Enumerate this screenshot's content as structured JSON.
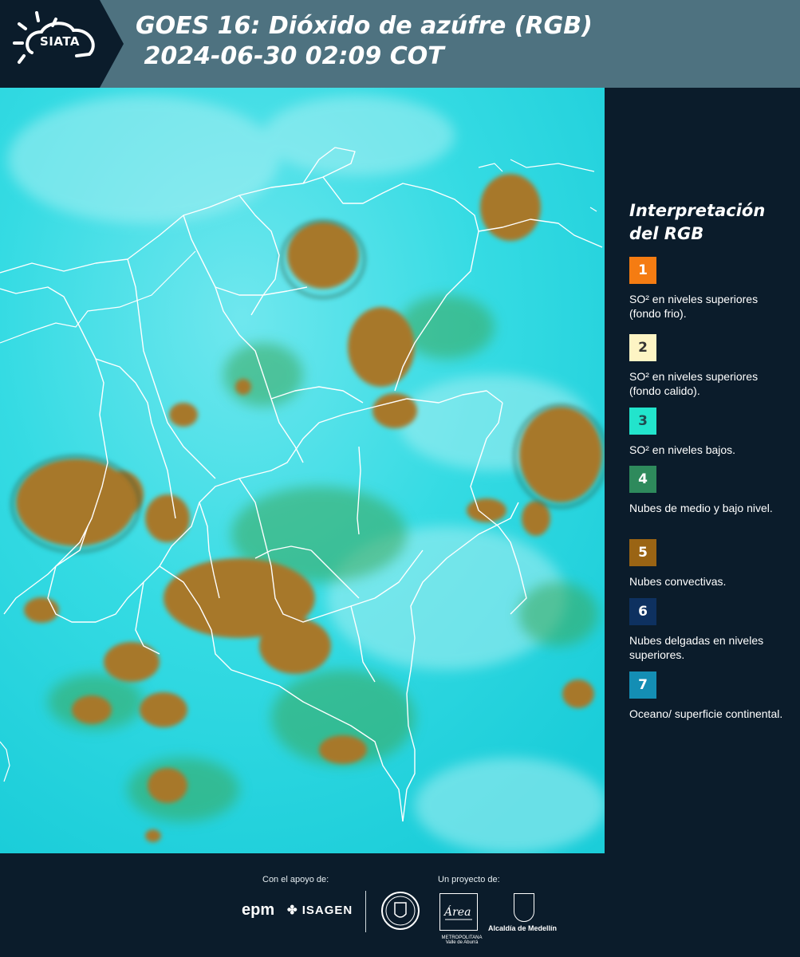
{
  "header": {
    "logo_text": "SIATA",
    "title_line1": "GOES 16: Dióxido de azúfre (RGB)",
    "title_line2": " 2024-06-30 02:09 COT"
  },
  "legend": {
    "title_line1": "Interpretación",
    "title_line2": "del RGB",
    "items": [
      {
        "number": "1",
        "color": "#f57c12",
        "text_color": "#ffffff",
        "label": "SO² en niveles superiores (fondo frio)."
      },
      {
        "number": "2",
        "color": "#fdf4c4",
        "text_color": "#333333",
        "label": "SO² en niveles superiores (fondo calido)."
      },
      {
        "number": "3",
        "color": "#22e4cc",
        "text_color": "#1f4a4f",
        "label": "SO² en niveles bajos."
      },
      {
        "number": "4",
        "color": "#2e8a5c",
        "text_color": "#ffffff",
        "label": "Nubes de medio y bajo nivel."
      },
      {
        "number": "5",
        "color": "#9a6414",
        "text_color": "#ffffff",
        "label": "Nubes convectivas."
      },
      {
        "number": "6",
        "color": "#0e3160",
        "text_color": "#ffffff",
        "label": "Nubes delgadas en niveles superiores."
      },
      {
        "number": "7",
        "color": "#148eb4",
        "text_color": "#ffffff",
        "label": "Oceano/ superficie continental."
      }
    ]
  },
  "footer": {
    "support_label": "Con el apoyo de:",
    "project_label": "Un proyecto de:",
    "sponsor_epm": "epm",
    "sponsor_isagen": "ISAGEN",
    "partner_area": "METROPOLITANA Valle de Aburrá",
    "partner_area_script": "Área",
    "partner_alcaldia": "Alcaldía de Medellín"
  },
  "colors": {
    "background": "#0b1c2b",
    "header": "#4e7280",
    "map_base": "#1fd6df",
    "convective_cloud": "#a7782a",
    "low_cloud_green": "#3aa85a",
    "borders": "#ffffff"
  }
}
